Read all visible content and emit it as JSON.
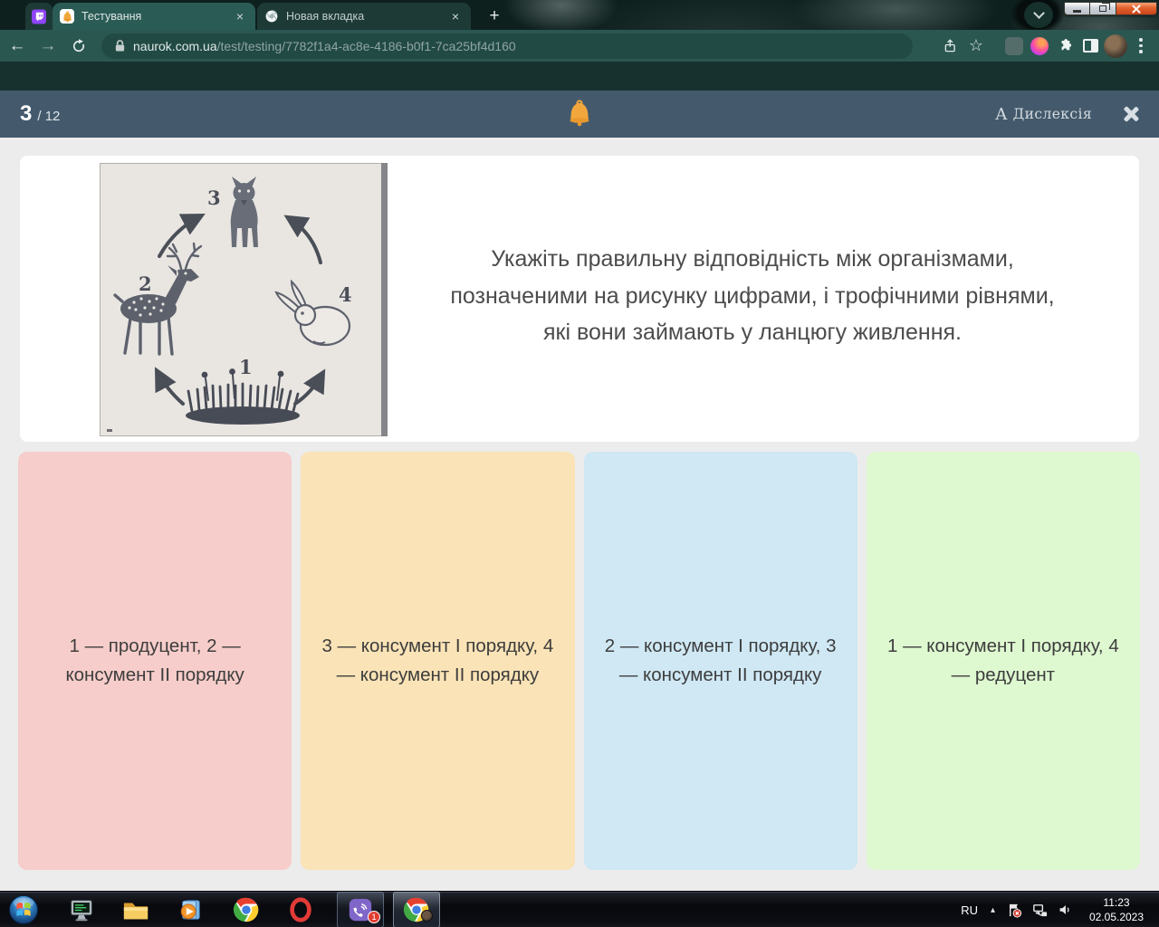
{
  "browser": {
    "pinned_tab": {
      "icon": "twitch-icon"
    },
    "tabs": [
      {
        "title": "Тестування",
        "favicon": "bell-icon"
      },
      {
        "title": "Новая вкладка",
        "favicon": "chrome-icon"
      }
    ],
    "toolbar": {
      "address": {
        "domain": "naurok.com.ua",
        "path": "/test/testing/7782f1a4-ac8e-4186-b0f1-7ca25bf4d160"
      }
    }
  },
  "glyphs": {
    "back": "←",
    "forward": "→",
    "star": "☆",
    "plus": "+",
    "tab_close": "×",
    "hidden_icons": "▴"
  },
  "quiz": {
    "progress": {
      "current": "3",
      "suffix": "/ 12"
    },
    "dyslexia": {
      "prefix": "А",
      "label": "Дислексія"
    },
    "question": "Укажіть правильну відповідність між організмами, позначеними на рисунку цифрами, і трофічними рівнями, які вони займають у ланцюгу живлення.",
    "diagram": {
      "numbers": [
        "1",
        "2",
        "3",
        "4"
      ]
    },
    "answers": [
      {
        "text": "1 — продуцент, 2 — консумент ІІ порядку",
        "color": "#f6cdca"
      },
      {
        "text": "3 — консумент І порядку, 4 — консумент ІІ порядку",
        "color": "#fae3b6"
      },
      {
        "text": "2 — консумент І порядку, 3 — консумент ІІ порядку",
        "color": "#cfe8f4"
      },
      {
        "text": "1 — консумент І порядку, 4 — редуцент",
        "color": "#def8d0"
      }
    ]
  },
  "taskbar": {
    "viber_badge": "1",
    "tray": {
      "language": "RU",
      "time": "11:23",
      "date": "02.05.2023"
    }
  },
  "colors": {
    "quiz_header": "#445a6c",
    "toolbar": "#2b5751",
    "bell": "#f2a73d"
  }
}
